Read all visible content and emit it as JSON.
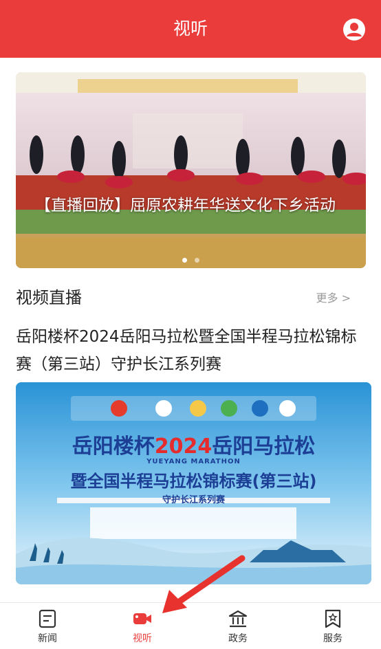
{
  "header": {
    "title": "视听",
    "user_icon": "user-circle-icon"
  },
  "banner": {
    "caption": "【直播回放】屈原农耕年华送文化下乡活动",
    "dots_count": 2,
    "active_dot": 1
  },
  "section": {
    "title": "视频直播",
    "more_label": "更多 >"
  },
  "video": {
    "title": "岳阳楼杯2024岳阳马拉松暨全国半程马拉松锦标赛（第三站）守护长江系列赛",
    "poster": {
      "line1_a": "岳阳楼杯",
      "line1_year": "2024",
      "line1_b": "岳阳马拉松",
      "subtitle": "YUEYANG MARATHON",
      "line2": "暨全国半程马拉松锦标赛(第三站)",
      "line3": "守护长江系列赛"
    }
  },
  "tabbar": {
    "tabs": [
      {
        "label": "新闻",
        "icon": "news-icon"
      },
      {
        "label": "视听",
        "icon": "video-camera-icon"
      },
      {
        "label": "政务",
        "icon": "government-icon"
      },
      {
        "label": "服务",
        "icon": "service-icon"
      }
    ],
    "active_index": 1
  },
  "colors": {
    "brand_red": "#ea3c3a",
    "poster_blue": "#2d9fd9",
    "muted_text": "#9a9a9a"
  }
}
